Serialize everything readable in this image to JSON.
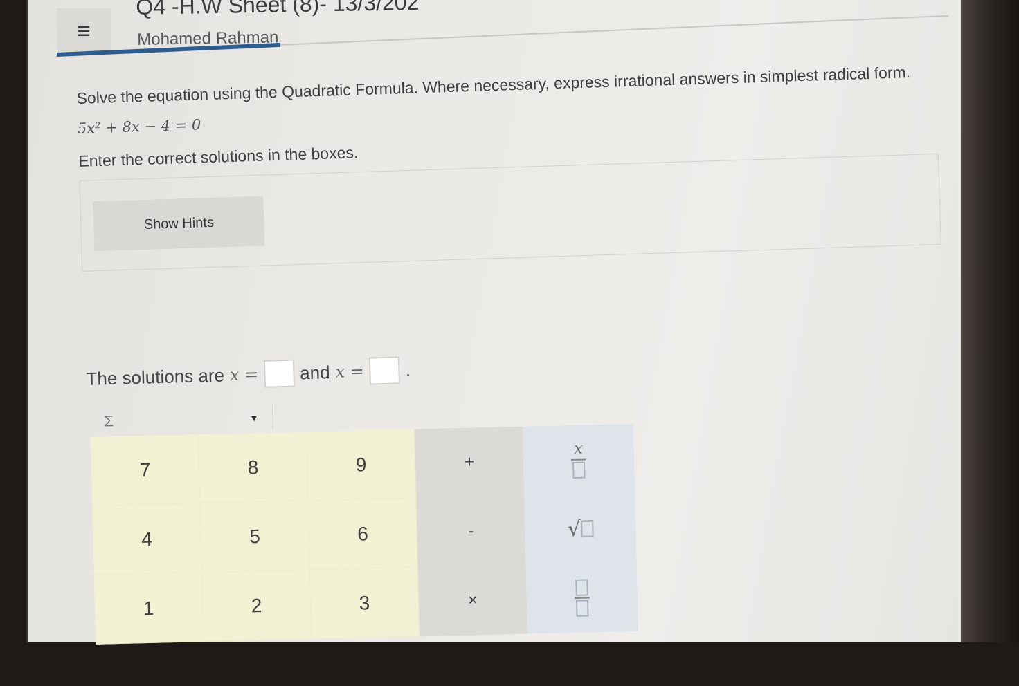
{
  "header": {
    "menu_icon": "≡",
    "title": "Q4 -H.W Sheet (8)- 13/3/202",
    "student_name": "Mohamed Rahman",
    "progress_fraction": 0.25
  },
  "question": {
    "instructions": "Solve the equation using the Quadratic Formula. Where necessary, express irrational answers in simplest radical form.",
    "equation": "5x² + 8x − 4 = 0",
    "enter_prompt": "Enter the correct solutions in the boxes.",
    "hint_button": "Show Hints"
  },
  "solutions": {
    "prefix": "The solutions are",
    "var1": "x =",
    "conjunction": "and",
    "var2": "x =",
    "suffix": ".",
    "answer1": "",
    "answer2": ""
  },
  "keypad": {
    "selector_label": "Σ",
    "selector_caret": "▼",
    "digits": [
      "7",
      "8",
      "9",
      "4",
      "5",
      "6",
      "1",
      "2",
      "3"
    ],
    "operators": [
      "+",
      "-",
      "×"
    ],
    "templates": {
      "fraction_x_numerator": "x",
      "sqrt_symbol": "√"
    }
  },
  "colors": {
    "accent": "#2f5c8f",
    "digit_key_bg": "#f3f1d4",
    "operator_key_bg": "#dcdad6",
    "template_key_bg": "#dfe4ea"
  }
}
